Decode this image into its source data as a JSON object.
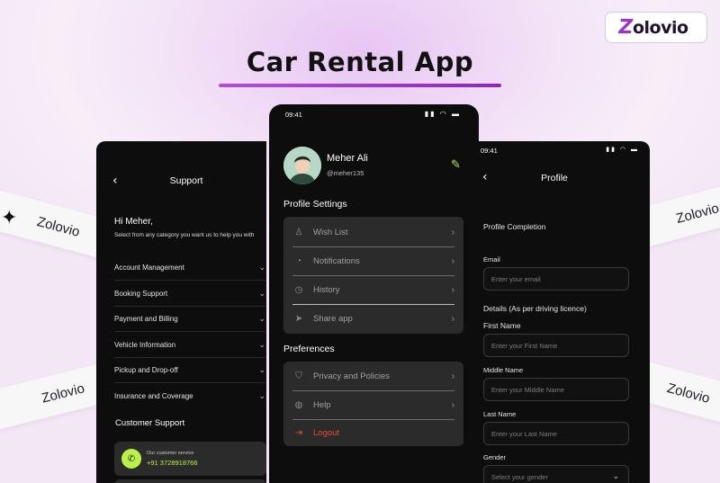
{
  "brand": {
    "z": "Z",
    "name": "olovio"
  },
  "title": "Car Rental App",
  "ribbons": [
    "Zolovio",
    "Zolovio",
    "Zolovio",
    "Zolovio"
  ],
  "support": {
    "title": "Support",
    "greeting": "Hi Meher,",
    "subtitle": "Select from any category you want us to help you with",
    "categories": [
      "Account Management",
      "Booking Support",
      "Payment and Billing",
      "Vehicle Information",
      "Pickup and Drop-off",
      "Insurance and Coverage"
    ],
    "customer_support_heading": "Customer Support",
    "service_label": "Our customer service",
    "service_phone": "+91 3728918766"
  },
  "profile_main": {
    "time": "09:41",
    "name": "Meher Ali",
    "handle": "@meher135",
    "settings_heading": "Profile Settings",
    "settings_items": [
      "Wish List",
      "Notifications",
      "History",
      "Share app"
    ],
    "preferences_heading": "Preferences",
    "preference_items": [
      "Privacy and Policies",
      "Help"
    ],
    "logout_label": "Logout",
    "accent_color": "#b9f04a",
    "logout_color": "#e0502f"
  },
  "profile_form": {
    "time": "09:41",
    "title": "Profile",
    "completion_heading": "Profile Completion",
    "email_label": "Email",
    "email_placeholder": "Enter your email",
    "details_heading": "Details (As per driving licence)",
    "first_name_label": "First Name",
    "first_name_placeholder": "Enter your First Name",
    "middle_name_label": "Middle Name",
    "middle_name_placeholder": "Enter your Middle Name",
    "last_name_label": "Last Name",
    "last_name_placeholder": "Enter your Last Name",
    "gender_label": "Gender",
    "gender_placeholder": "Select your gender"
  }
}
